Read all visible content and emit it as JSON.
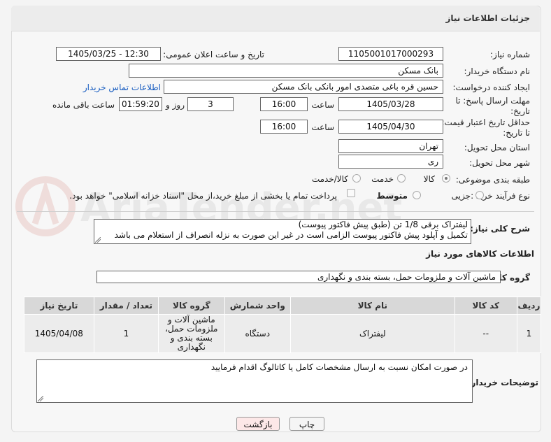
{
  "header": {
    "title": "جزئیات اطلاعات نیاز"
  },
  "fields": {
    "need_number_label": "شماره نیاز:",
    "need_number": "1105001017000293",
    "announce_label": "تاریخ و ساعت اعلان عمومی:",
    "announce_value": "1405/03/25 - 12:30",
    "buyer_org_label": "نام دستگاه خریدار:",
    "buyer_org": "بانک مسکن",
    "creator_label": "ایجاد کننده درخواست:",
    "creator": "حسین  قره باغی متصدی امور بانکی بانک مسکن",
    "contact_link": "اطلاعات تماس خریدار",
    "deadline_label_1": "مهلت ارسال پاسخ: تا",
    "deadline_label_2": "تاریخ:",
    "deadline_date": "1405/03/28",
    "time_label": "ساعت",
    "deadline_time": "16:00",
    "days_value": "3",
    "days_label": "روز و",
    "remaining_time": "01:59:20",
    "remaining_label": "ساعت باقی مانده",
    "min_validity_label_1": "حداقل تاریخ اعتبار قیمت:",
    "min_validity_label_2": "تا تاریخ:",
    "validity_date": "1405/04/30",
    "validity_time": "16:00",
    "province_label": "استان محل تحویل:",
    "province": "تهران",
    "city_label": "شهر محل تحویل:",
    "city": "ری",
    "category_label": "طبقه بندی موضوعی:",
    "category_options": [
      "کالا",
      "خدمت",
      "کالا/خدمت"
    ],
    "purchase_type_label": "نوع فرآیند خرید :",
    "purchase_options": [
      "جزیی",
      "متوسط"
    ],
    "payment_note": "پرداخت تمام یا بخشی از مبلغ خرید،از محل \"اسناد خزانه اسلامی\" خواهد بود."
  },
  "description": {
    "label": "شرح کلی نیاز:",
    "line1": "لیفتراک برقی 1/8 تن (طبق پیش فاکتور پیوست)",
    "line2": "تکمیل و آپلود پیش فاکتور پیوست الزامی است در غیر این صورت به نزله انصراف از استعلام می باشد"
  },
  "goods_section": {
    "title": "اطلاعات کالاهای مورد نیاز",
    "group_label": "گروه کالا:",
    "group_value": "ماشین آلات و ملزومات حمل، بسته بندی و نگهداری"
  },
  "table": {
    "headers": [
      "ردیف",
      "کد کالا",
      "نام کالا",
      "واحد شمارش",
      "گروه کالا",
      "تعداد / مقدار",
      "تاریخ نیاز"
    ],
    "rows": [
      {
        "row": "1",
        "code": "--",
        "name": "لیفتراک",
        "unit": "دستگاه",
        "group": "ماشین آلات و ملزومات حمل، بسته بندی و نگهداری",
        "qty": "1",
        "date": "1405/04/08"
      }
    ]
  },
  "buyer_notes": {
    "label": "توضیحات خریدار:",
    "text": "در صورت امکان نسبت به ارسال مشخصات کامل یا کاتالوگ اقدام فرمایید"
  },
  "buttons": {
    "print": "چاپ",
    "back": "بازگشت"
  },
  "watermark": {
    "text": "AriaTender.net"
  },
  "colors": {
    "link": "#1a5ec1",
    "back_button_bg": "#fde8e8"
  }
}
